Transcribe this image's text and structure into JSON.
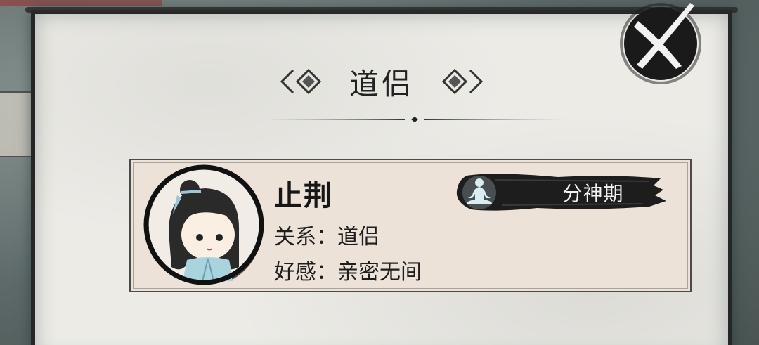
{
  "dialog": {
    "title": "道侣"
  },
  "character": {
    "name": "止荆",
    "relation_label": "关系：",
    "relation_value": "道侣",
    "affinity_label": "好感：",
    "affinity_value": "亲密无间",
    "realm": "分神期"
  },
  "icons": {
    "close": "close-x-brush-icon",
    "realm": "meditation-figure-icon",
    "title_ornament": "double-diamond-ornament-icon"
  },
  "colors": {
    "panel_bg": "#ecebe6",
    "card_bg": "#ede2d8",
    "ink": "#1e1e1e",
    "realm_glow": "#cfe8ee"
  }
}
